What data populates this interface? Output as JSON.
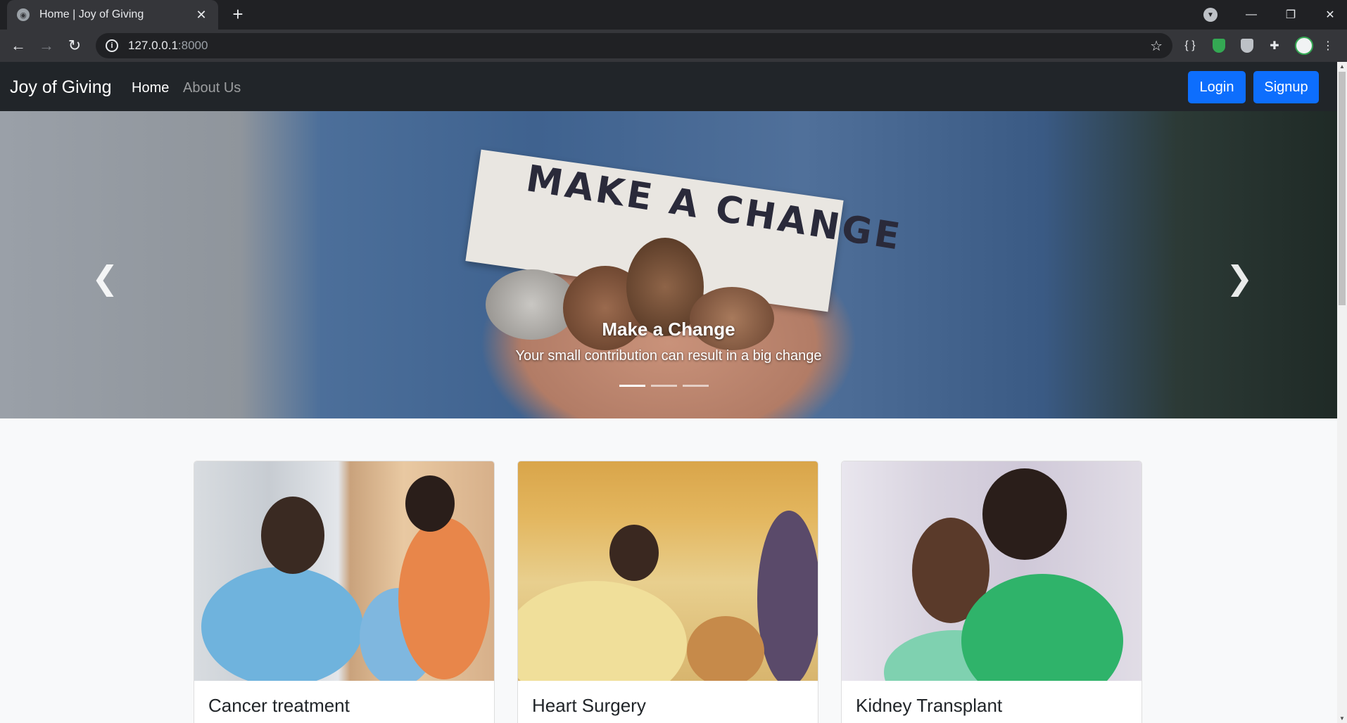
{
  "browser": {
    "tab_title": "Home | Joy of Giving",
    "url_host": "127.0.0.1",
    "url_port": ":8000"
  },
  "site": {
    "brand": "Joy of Giving",
    "nav": [
      {
        "label": "Home",
        "active": true
      },
      {
        "label": "About Us",
        "active": false
      }
    ],
    "login_label": "Login",
    "signup_label": "Signup"
  },
  "carousel": {
    "image_text": "MAKE A CHANGE",
    "caption_title": "Make a Change",
    "caption_text": "Your small contribution can result in a big change",
    "slide_count": 3,
    "active_slide": 1
  },
  "cards": [
    {
      "title": "Cancer treatment"
    },
    {
      "title": "Heart Surgery"
    },
    {
      "title": "Kidney Transplant"
    }
  ],
  "colors": {
    "navbar": "#212529",
    "primary_button": "#0d6efd",
    "page_background": "#f8f9fa"
  }
}
